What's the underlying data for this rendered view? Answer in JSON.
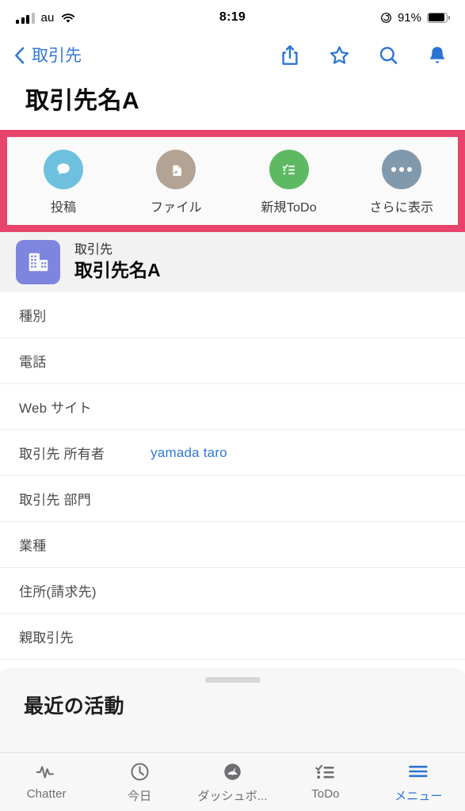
{
  "status_bar": {
    "carrier": "au",
    "time": "8:19",
    "battery_percent": "91%",
    "signal_icon": "cellular-signal-icon",
    "wifi_icon": "wifi-icon",
    "rotation_lock_icon": "rotation-lock-icon",
    "battery_icon": "battery-icon"
  },
  "nav_bar": {
    "back_label": "取引先",
    "back_icon": "chevron-left-icon",
    "actions": [
      {
        "name": "share-icon",
        "label": "共有"
      },
      {
        "name": "star-icon",
        "label": "お気に入り"
      },
      {
        "name": "search-icon",
        "label": "検索"
      },
      {
        "name": "bell-icon",
        "label": "通知"
      }
    ]
  },
  "page": {
    "title": "取引先名A"
  },
  "highlight": {
    "color": "#e8436b"
  },
  "quick_actions": [
    {
      "label": "投稿",
      "icon": "chat-bubble-icon",
      "color": "#6ec1de"
    },
    {
      "label": "ファイル",
      "icon": "file-upload-icon",
      "color": "#b3a394"
    },
    {
      "label": "新規ToDo",
      "icon": "checklist-icon",
      "color": "#5dba62"
    },
    {
      "label": "さらに表示",
      "icon": "ellipsis-icon",
      "color": "#8199ac"
    }
  ],
  "record": {
    "kind": "取引先",
    "name": "取引先名A",
    "avatar_icon": "building-icon",
    "avatar_color": "#7d85de",
    "fields": [
      {
        "label": "種別",
        "value": ""
      },
      {
        "label": "電話",
        "value": ""
      },
      {
        "label": "Web サイト",
        "value": ""
      },
      {
        "label": "取引先 所有者",
        "value": "yamada taro"
      },
      {
        "label": "取引先 部門",
        "value": ""
      },
      {
        "label": "業種",
        "value": ""
      },
      {
        "label": "住所(請求先)",
        "value": ""
      },
      {
        "label": "親取引先",
        "value": ""
      }
    ]
  },
  "bottom_sheet": {
    "title": "最近の活動",
    "grabber": "sheet-grabber"
  },
  "tab_bar": {
    "active_index": 4,
    "active_color": "#2a74d4",
    "items": [
      {
        "label": "Chatter",
        "icon": "pulse-icon"
      },
      {
        "label": "今日",
        "icon": "clock-icon"
      },
      {
        "label": "ダッシュボ...",
        "icon": "gauge-icon"
      },
      {
        "label": "ToDo",
        "icon": "checklist-icon"
      },
      {
        "label": "メニュー",
        "icon": "hamburger-menu-icon"
      }
    ]
  }
}
